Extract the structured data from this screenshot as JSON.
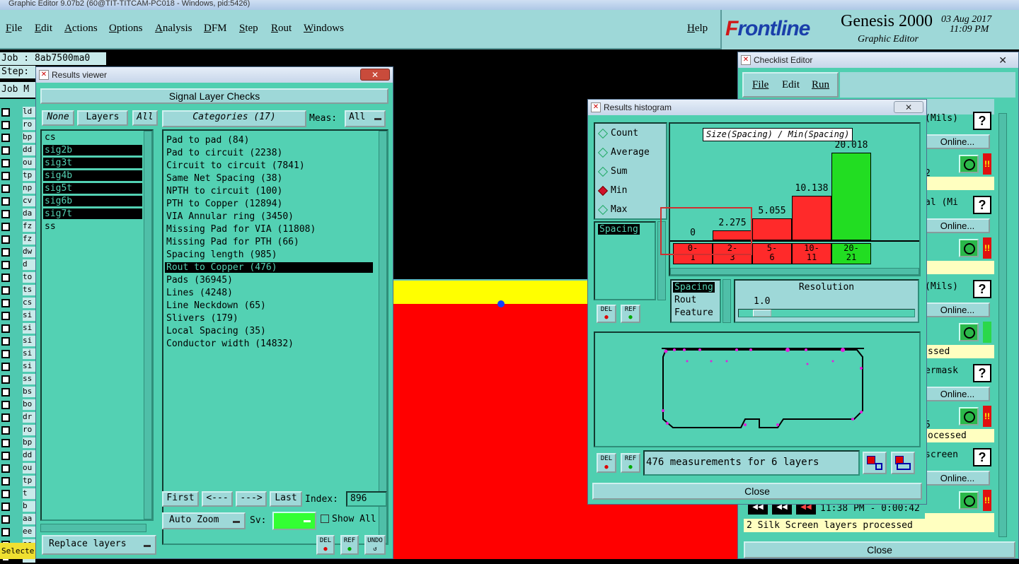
{
  "os_title": "Graphic Editor 9.07b2 (60@TIT-TITCAM-PC018 - Windows, pid:5426)",
  "menu": {
    "file": "File",
    "edit": "Edit",
    "actions": "Actions",
    "options": "Options",
    "analysis": "Analysis",
    "dfm": "DFM",
    "step": "Step",
    "rout": "Rout",
    "windows": "Windows",
    "help": "Help"
  },
  "brand": {
    "logo_f": "F",
    "logo_rest": "rontline",
    "product": "Genesis 2000",
    "subtitle": "Graphic Editor",
    "date": "03 Aug 2017",
    "time": "11:09 PM"
  },
  "workspace": {
    "job_label": "Job : 8ab7500ma0",
    "step_label": "Step:",
    "job_m_label": "Job M",
    "select_label": "Selecte",
    "left_layers": [
      "ld",
      "ro",
      "bp",
      "dd",
      "ou",
      "tp",
      "np",
      "cv",
      "da",
      "fz",
      "fz",
      "dw",
      "d",
      "to",
      "ts",
      "cs",
      "si",
      "si",
      "si",
      "si",
      "si",
      "ss",
      "bs",
      "bo",
      "dr",
      "ro",
      "bp",
      "dd",
      "ou",
      "tp",
      "t",
      "b",
      "aa",
      "ee",
      "ee",
      "aa"
    ]
  },
  "results_viewer": {
    "title": "Results viewer",
    "close": "✕",
    "header": "Signal Layer Checks",
    "none_btn": "None",
    "layers_btn": "Layers",
    "all_btn": "All",
    "categories_label": "Categories (17)",
    "meas_label": "Meas:",
    "meas_value": "All",
    "layers": [
      {
        "name": "cs",
        "selected": false
      },
      {
        "name": "sig2b",
        "selected": true
      },
      {
        "name": "sig3t",
        "selected": true
      },
      {
        "name": "sig4b",
        "selected": true
      },
      {
        "name": "sig5t",
        "selected": true
      },
      {
        "name": "sig6b",
        "selected": true
      },
      {
        "name": "sig7t",
        "selected": true
      },
      {
        "name": "ss",
        "selected": false
      }
    ],
    "categories": [
      {
        "label": "Pad to pad (84)",
        "selected": false
      },
      {
        "label": "Pad to circuit (2238)",
        "selected": false
      },
      {
        "label": "Circuit to circuit (7841)",
        "selected": false
      },
      {
        "label": "Same Net Spacing (38)",
        "selected": false
      },
      {
        "label": "NPTH to circuit (100)",
        "selected": false
      },
      {
        "label": "PTH to Copper (12894)",
        "selected": false
      },
      {
        "label": "VIA Annular ring (3450)",
        "selected": false
      },
      {
        "label": "Missing Pad for VIA (11808)",
        "selected": false
      },
      {
        "label": "Missing Pad for PTH (66)",
        "selected": false
      },
      {
        "label": "Spacing length (985)",
        "selected": false
      },
      {
        "label": "Rout to Copper (476)",
        "selected": true
      },
      {
        "label": "Pads (36945)",
        "selected": false
      },
      {
        "label": "Lines (4248)",
        "selected": false
      },
      {
        "label": "Line Neckdown (65)",
        "selected": false
      },
      {
        "label": "Slivers (179)",
        "selected": false
      },
      {
        "label": "Local Spacing (35)",
        "selected": false
      },
      {
        "label": "Conductor width (14832)",
        "selected": false
      }
    ],
    "first_btn": "First",
    "prev_btn": "<---",
    "next_btn": "--->",
    "last_btn": "Last",
    "index_label": "Index:",
    "index_value": "896",
    "auto_zoom": "Auto Zoom",
    "sv_label": "Sv:",
    "show_all": "Show All",
    "replace_layers": "Replace layers",
    "del_btn": "DEL",
    "ref_btn": "REF",
    "undo_btn": "UNDO"
  },
  "histogram": {
    "title": "Results histogram",
    "close": "✕",
    "options": [
      {
        "label": "Count",
        "selected": false
      },
      {
        "label": "Average",
        "selected": false
      },
      {
        "label": "Sum",
        "selected": false
      },
      {
        "label": "Min",
        "selected": true
      },
      {
        "label": "Max",
        "selected": false
      }
    ],
    "measure_item": "Spacing",
    "chart_title": "Size(Spacing) / Min(Spacing)",
    "bars": [
      {
        "bin": "0-\n1",
        "value": 0,
        "label": "0",
        "color": "#ff2a2a"
      },
      {
        "bin": "2-\n3",
        "value": 2.275,
        "label": "2.275",
        "color": "#ff2a2a"
      },
      {
        "bin": "5-\n6",
        "value": 5.055,
        "label": "5.055",
        "color": "#ff2a2a"
      },
      {
        "bin": "10-\n11",
        "value": 10.138,
        "label": "10.138",
        "color": "#ff2a2a"
      },
      {
        "bin": "20-\n21",
        "value": 20.018,
        "label": "20.018",
        "color": "#22dd22"
      }
    ],
    "size_list": [
      "Spacing",
      "Rout",
      "Feature"
    ],
    "resolution_label": "Resolution",
    "resolution_value": "1.0",
    "status": "476 measurements for 6 layers",
    "close_btn": "Close",
    "del_btn": "DEL",
    "ref_btn": "REF"
  },
  "checklist": {
    "title": "Checklist Editor",
    "menu_file": "File",
    "menu_edit": "Edit",
    "menu_run": "Run",
    "rows": [
      {
        "unit": "(Mils)",
        "online": "Online...",
        "yellow": "",
        "bang": true
      },
      {
        "unit": "al (Mi",
        "online": "Online...",
        "yellow": "",
        "bang": true
      },
      {
        "unit": "(Mils)",
        "online": "Online...",
        "yellow": "ssed",
        "bang": false
      },
      {
        "unit": "ermask",
        "online": "Online...",
        "yellow": "ocessed",
        "bang": true
      },
      {
        "unit": "screen",
        "online": "Online...",
        "yellow": "",
        "bang": true
      }
    ],
    "partial_num_2": "2",
    "partial_num_5": "5",
    "time_row": "11:38 PM - 0:00:42",
    "silk_status": "2 Silk Screen layers processed",
    "close_btn": "Close"
  }
}
